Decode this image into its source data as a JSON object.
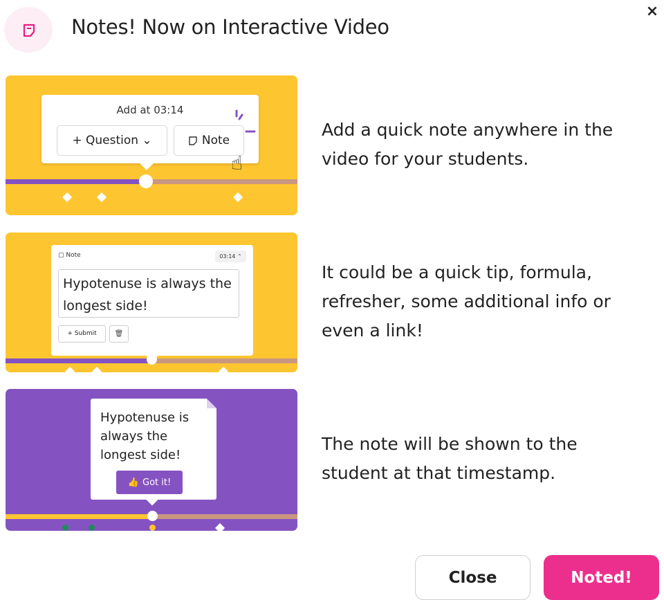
{
  "header": {
    "title": "Notes! Now on Interactive Video",
    "close_glyph": "×",
    "icon": "note-icon",
    "accent": "#e71b83"
  },
  "panels": [
    {
      "bg": "#fdc530",
      "card": {
        "add_at": "Add at 03:14",
        "question_label": "+ Question ⌄",
        "note_label": "Note"
      },
      "description": "Add a quick note anywhere in the video for your students."
    },
    {
      "bg": "#fdc530",
      "card": {
        "note_label": "Note",
        "time": "03:14",
        "text": "Hypotenuse is always the longest side!",
        "submit_label": "+ Submit",
        "trash_icon": "trash-icon"
      },
      "description": "It could be a quick tip, formula, refresher, some additional info or even a link!"
    },
    {
      "bg": "#8553c1",
      "card": {
        "text": "Hypotenuse is always the longest side!",
        "got_it_label": "Got it!"
      },
      "description": "The note will be shown to the student at that timestamp."
    }
  ],
  "footer": {
    "close_label": "Close",
    "noted_label": "Noted!",
    "noted_color": "#ec2f8d"
  },
  "colors": {
    "yellow": "#fdc530",
    "purple": "#8553c1",
    "track_played": "#8553c1",
    "track_remaining": "#c9977f",
    "green": "#1e8c5a"
  }
}
